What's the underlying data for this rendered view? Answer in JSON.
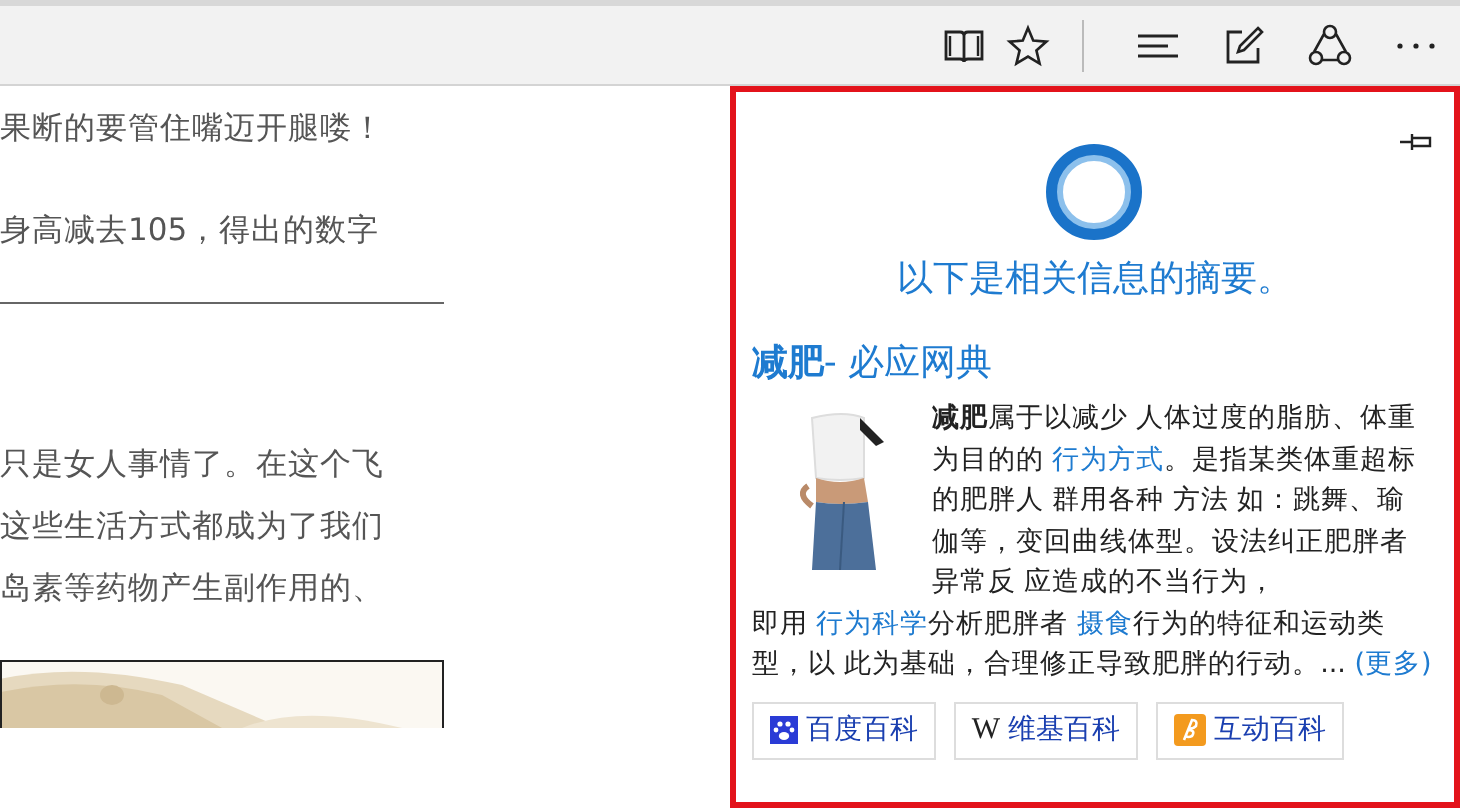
{
  "article": {
    "blocks": [
      {
        "kind": "text",
        "lines": [
          "果断的要管住嘴迈开腿喽！"
        ]
      },
      {
        "kind": "text",
        "lines": [
          "身高减去105，得出的数字"
        ]
      },
      {
        "kind": "rule"
      },
      {
        "kind": "text",
        "lines": [
          "只是女人事情了。在这个飞",
          "这些生活方式都成为了我们",
          "岛素等药物产生副作用的、"
        ]
      },
      {
        "kind": "picture"
      }
    ]
  },
  "panel": {
    "heading": "以下是相关信息的摘要。",
    "entry": {
      "title": "减肥",
      "source": "- 必应网典"
    },
    "summary": [
      [
        {
          "kind": "bold",
          "text": "减肥"
        },
        {
          "kind": "text",
          "text": "属于以减少 人体过度的脂肪、体重为目的的 "
        },
        {
          "kind": "link",
          "text": "行为方式"
        },
        {
          "kind": "text",
          "text": "。是指某类体重超标的肥胖人 群用各种 方法 如：跳舞、瑜伽等，变回曲线体型。设法纠正肥胖者异常反 应造成的不当行为，"
        }
      ],
      [
        {
          "kind": "text",
          "text": "即用 "
        },
        {
          "kind": "link",
          "text": "行为科学"
        },
        {
          "kind": "text",
          "text": "分析肥胖者 "
        },
        {
          "kind": "link",
          "text": "摄食"
        },
        {
          "kind": "text",
          "text": "行为的特征和运动类型，以 此为基础，合理修正导致肥胖的行动。... "
        },
        {
          "kind": "link",
          "text": "(更多)"
        }
      ]
    ],
    "sources": [
      {
        "kind": "baidu",
        "label": "百度百科"
      },
      {
        "kind": "wiki",
        "icon_text": "W",
        "label": "维基百科"
      },
      {
        "kind": "hudong",
        "label": "互动百科"
      }
    ]
  }
}
